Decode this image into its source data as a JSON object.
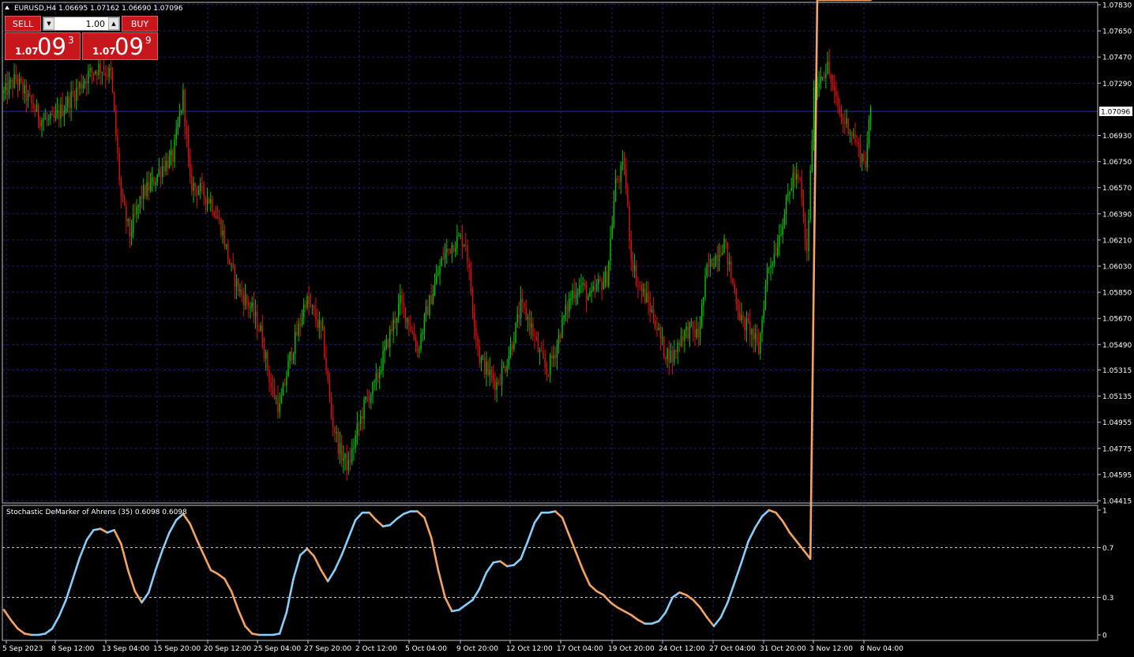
{
  "header": {
    "symbol_info": "EURUSD,H4  1.06695 1.07162 1.06690 1.07096"
  },
  "trade_panel": {
    "sell_label": "SELL",
    "buy_label": "BUY",
    "lot_value": "1.00",
    "sell_price_small": "1.07",
    "sell_price_big": "09",
    "sell_price_sup": "3",
    "buy_price_small": "1.07",
    "buy_price_big": "09",
    "buy_price_sup": "9"
  },
  "colors": {
    "background": "#000000",
    "grid": "#1b1b72",
    "bull": "#00c800",
    "bear": "#e01010",
    "rising": "#87cefa",
    "falling": "#f4a460",
    "bid_line": "#2030b0",
    "frame": "#c0c0c0"
  },
  "chart_data": [
    {
      "type": "candlestick",
      "symbol": "EURUSD",
      "timeframe": "H4",
      "ylim": [
        1.04415,
        1.0783
      ],
      "y_ticks": [
        "1.07830",
        "1.07650",
        "1.07470",
        "1.07290",
        "1.07096",
        "1.06930",
        "1.06750",
        "1.06570",
        "1.06390",
        "1.06210",
        "1.06030",
        "1.05850",
        "1.05670",
        "1.05490",
        "1.05315",
        "1.05135",
        "1.04955",
        "1.04775",
        "1.04595",
        "1.04415"
      ],
      "current_price": 1.07096,
      "current_price_label": "1.07096",
      "x_ticks": [
        "5 Sep 2023",
        "8 Sep 12:00",
        "13 Sep 04:00",
        "15 Sep 20:00",
        "20 Sep 12:00",
        "25 Sep 04:00",
        "27 Sep 20:00",
        "2 Oct 12:00",
        "5 Oct 04:00",
        "9 Oct 20:00",
        "12 Oct 12:00",
        "17 Oct 04:00",
        "19 Oct 20:00",
        "24 Oct 12:00",
        "27 Oct 04:00",
        "31 Oct 20:00",
        "3 Nov 12:00",
        "8 Nov 04:00"
      ],
      "close_path": [
        [
          0,
          1.0722
        ],
        [
          7,
          1.0732
        ],
        [
          14,
          1.0718
        ],
        [
          21,
          1.0705
        ],
        [
          28,
          1.0702
        ],
        [
          35,
          1.0713
        ],
        [
          42,
          1.0724
        ],
        [
          49,
          1.0735
        ],
        [
          55,
          1.074
        ],
        [
          62,
          1.0735
        ],
        [
          68,
          1.065
        ],
        [
          73,
          1.0625
        ],
        [
          80,
          1.0652
        ],
        [
          86,
          1.066
        ],
        [
          92,
          1.0672
        ],
        [
          98,
          1.0678
        ],
        [
          104,
          1.072
        ],
        [
          108,
          1.066
        ],
        [
          114,
          1.0655
        ],
        [
          120,
          1.0648
        ],
        [
          126,
          1.063
        ],
        [
          132,
          1.06
        ],
        [
          137,
          1.0585
        ],
        [
          143,
          1.0575
        ],
        [
          149,
          1.0558
        ],
        [
          155,
          1.052
        ],
        [
          160,
          1.0505
        ],
        [
          166,
          1.054
        ],
        [
          171,
          1.056
        ],
        [
          175,
          1.058
        ],
        [
          180,
          1.057
        ],
        [
          185,
          1.0555
        ],
        [
          190,
          1.05
        ],
        [
          195,
          1.0475
        ],
        [
          200,
          1.0465
        ],
        [
          205,
          1.049
        ],
        [
          210,
          1.051
        ],
        [
          215,
          1.052
        ],
        [
          220,
          1.054
        ],
        [
          225,
          1.056
        ],
        [
          230,
          1.0578
        ],
        [
          235,
          1.0565
        ],
        [
          240,
          1.0545
        ],
        [
          245,
          1.057
        ],
        [
          250,
          1.059
        ],
        [
          255,
          1.061
        ],
        [
          260,
          1.0618
        ],
        [
          264,
          1.0622
        ],
        [
          268,
          1.062
        ],
        [
          272,
          1.0575
        ],
        [
          276,
          1.054
        ],
        [
          281,
          1.053
        ],
        [
          286,
          1.0522
        ],
        [
          291,
          1.0535
        ],
        [
          296,
          1.0555
        ],
        [
          300,
          1.0575
        ],
        [
          305,
          1.0565
        ],
        [
          310,
          1.0545
        ],
        [
          315,
          1.053
        ],
        [
          320,
          1.0545
        ],
        [
          325,
          1.0568
        ],
        [
          330,
          1.0585
        ],
        [
          335,
          1.059
        ],
        [
          340,
          1.058
        ],
        [
          345,
          1.059
        ],
        [
          350,
          1.0595
        ],
        [
          355,
          1.066
        ],
        [
          360,
          1.0672
        ],
        [
          364,
          1.061
        ],
        [
          368,
          1.059
        ],
        [
          373,
          1.058
        ],
        [
          378,
          1.0565
        ],
        [
          383,
          1.0545
        ],
        [
          388,
          1.054
        ],
        [
          393,
          1.0555
        ],
        [
          398,
          1.056
        ],
        [
          403,
          1.0555
        ],
        [
          408,
          1.06
        ],
        [
          413,
          1.061
        ],
        [
          418,
          1.062
        ],
        [
          423,
          1.059
        ],
        [
          428,
          1.0565
        ],
        [
          433,
          1.056
        ],
        [
          438,
          1.0545
        ],
        [
          443,
          1.06
        ],
        [
          448,
          1.0615
        ],
        [
          453,
          1.064
        ],
        [
          458,
          1.0665
        ],
        [
          462,
          1.066
        ],
        [
          466,
          1.061
        ],
        [
          470,
          1.072
        ],
        [
          474,
          1.0735
        ],
        [
          478,
          1.074
        ],
        [
          482,
          1.072
        ],
        [
          486,
          1.0705
        ],
        [
          490,
          1.07
        ],
        [
          494,
          1.069
        ],
        [
          497,
          1.068
        ],
        [
          500,
          1.0675
        ],
        [
          503,
          1.071
        ]
      ]
    },
    {
      "type": "line",
      "title": "Stochastic DeMarker of Ahrens (35) 0.6098 0.6098",
      "ylim": [
        0,
        1
      ],
      "y_ticks": [
        "1",
        "0.7",
        "0.3",
        "0"
      ],
      "levels": [
        0.7,
        0.3
      ],
      "x": [
        0,
        4,
        8,
        12,
        16,
        20,
        24,
        28,
        32,
        36,
        40,
        44,
        48,
        52,
        56,
        60,
        64,
        68,
        72,
        76,
        80,
        84,
        88,
        92,
        96,
        100,
        104,
        108,
        112,
        116,
        120,
        124,
        128,
        132,
        136,
        140,
        144,
        148,
        152,
        156,
        160,
        164,
        168,
        172,
        176,
        180,
        184,
        188,
        192,
        196,
        200,
        204,
        208,
        212,
        216,
        220,
        224,
        228,
        232,
        236,
        240,
        244,
        248,
        252,
        256,
        260,
        264,
        268,
        272,
        276,
        280,
        284,
        288,
        292,
        296,
        300,
        304,
        308,
        312,
        316,
        320,
        324,
        328,
        332,
        336,
        340,
        344,
        348,
        352,
        356,
        360,
        364,
        368,
        372,
        376,
        380,
        384,
        388,
        392,
        396,
        400,
        404,
        408,
        412,
        416,
        420,
        424,
        428,
        432,
        436,
        440,
        444,
        448,
        452,
        456,
        460,
        464,
        468,
        472,
        476,
        480,
        484,
        488,
        492,
        496,
        500,
        503
      ],
      "values": [
        0.2,
        0.12,
        0.05,
        0.01,
        0.0,
        0.0,
        0.01,
        0.05,
        0.15,
        0.28,
        0.45,
        0.62,
        0.76,
        0.84,
        0.85,
        0.82,
        0.84,
        0.73,
        0.52,
        0.35,
        0.26,
        0.34,
        0.52,
        0.68,
        0.82,
        0.92,
        0.97,
        0.89,
        0.76,
        0.64,
        0.52,
        0.49,
        0.45,
        0.35,
        0.2,
        0.07,
        0.01,
        0.0,
        0.0,
        0.0,
        0.01,
        0.18,
        0.45,
        0.64,
        0.69,
        0.63,
        0.52,
        0.43,
        0.52,
        0.64,
        0.78,
        0.92,
        0.98,
        0.98,
        0.92,
        0.87,
        0.88,
        0.93,
        0.97,
        0.99,
        0.99,
        0.94,
        0.78,
        0.52,
        0.3,
        0.19,
        0.2,
        0.24,
        0.28,
        0.37,
        0.5,
        0.58,
        0.59,
        0.55,
        0.56,
        0.61,
        0.75,
        0.9,
        0.98,
        0.98,
        0.99,
        0.94,
        0.8,
        0.66,
        0.52,
        0.4,
        0.35,
        0.32,
        0.26,
        0.22,
        0.19,
        0.16,
        0.12,
        0.09,
        0.09,
        0.11,
        0.18,
        0.3,
        0.34,
        0.32,
        0.28,
        0.22,
        0.14,
        0.07,
        0.14,
        0.26,
        0.42,
        0.58,
        0.75,
        0.86,
        0.95,
        1.0,
        0.98,
        0.91,
        0.82,
        0.75,
        0.68,
        0.6098
      ]
    }
  ]
}
